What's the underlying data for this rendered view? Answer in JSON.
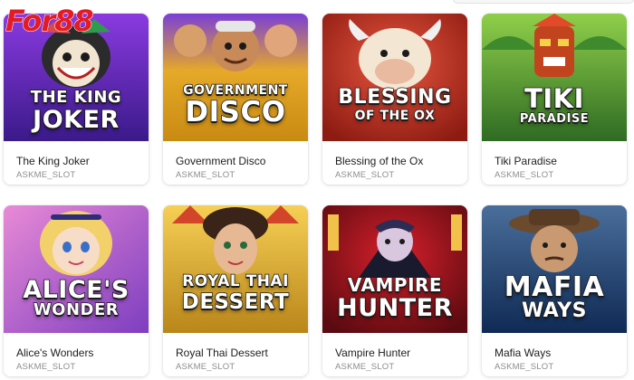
{
  "logo": {
    "text": "For88"
  },
  "colors": {
    "brand_red": "#e31b23",
    "card_title": "#1e1e1e",
    "card_provider": "#8c8c8c"
  },
  "games": [
    {
      "name": "The King Joker",
      "provider": "ASKME_SLOT",
      "art_line1": "THE KING",
      "art_line2": "JOKER",
      "bg": [
        "#7a2fd3",
        "#3b1a8a"
      ],
      "accent": "#d94b4b"
    },
    {
      "name": "Government Disco",
      "provider": "ASKME_SLOT",
      "art_line1": "GOVERNMENT",
      "art_line2": "DISCO",
      "bg": [
        "#f3c13c",
        "#c98a12"
      ],
      "accent": "#7a3fd6"
    },
    {
      "name": "Blessing of the Ox",
      "provider": "ASKME_SLOT",
      "art_line1": "BLESSING",
      "art_line2": "OF THE OX",
      "bg": [
        "#d43a2c",
        "#8d1b12"
      ],
      "accent": "#e9c8a0"
    },
    {
      "name": "Tiki Paradise",
      "provider": "ASKME_SLOT",
      "art_line1": "TIKI",
      "art_line2": "PARADISE",
      "bg": [
        "#5aa63d",
        "#2f6b23"
      ],
      "accent": "#e24a2a"
    },
    {
      "name": "Alice's Wonders",
      "provider": "ASKME_SLOT",
      "art_line1": "ALICE'S",
      "art_line2": "WONDER",
      "bg": [
        "#d77ad8",
        "#7e3ec0"
      ],
      "accent": "#f2d16b"
    },
    {
      "name": "Royal Thai Dessert",
      "provider": "ASKME_SLOT",
      "art_line1": "ROYAL THAI",
      "art_line2": "DESSERT",
      "bg": [
        "#f0b93a",
        "#b9861a"
      ],
      "accent": "#8a4b2a"
    },
    {
      "name": "Vampire Hunter",
      "provider": "ASKME_SLOT",
      "art_line1": "VAMPIRE",
      "art_line2": "HUNTER",
      "bg": [
        "#b4151e",
        "#5a0a10"
      ],
      "accent": "#3b4a73"
    },
    {
      "name": "Mafia Ways",
      "provider": "ASKME_SLOT",
      "art_line1": "MAFIA",
      "art_line2": "WAYS",
      "bg": [
        "#2a5aa6",
        "#0f2a55"
      ],
      "accent": "#6b4a2e"
    }
  ]
}
